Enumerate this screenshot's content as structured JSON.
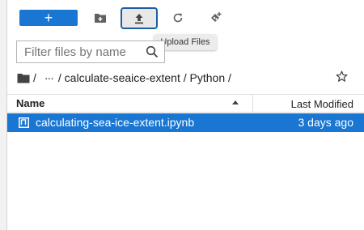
{
  "toolbar": {
    "new_label": "+",
    "tooltip": "Upload Files"
  },
  "search": {
    "placeholder": "Filter files by name",
    "value": ""
  },
  "breadcrumb": {
    "root_sep": "/",
    "ellipsis": "···",
    "path": "/ calculate-seaice-extent / Python /"
  },
  "table": {
    "columns": [
      "Name",
      "Last Modified"
    ],
    "rows": [
      {
        "name": "calculating-sea-ice-extent.ipynb",
        "modified": "3 days ago",
        "selected": true
      }
    ]
  },
  "colors": {
    "accent": "#1976d2",
    "focus_border": "#1a5fa3"
  }
}
